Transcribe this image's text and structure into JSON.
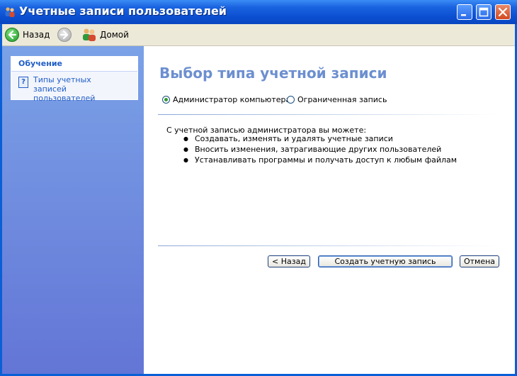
{
  "window": {
    "title": "Учетные записи пользователей",
    "accent": "#0a5fd6"
  },
  "toolbar": {
    "back_label": "Назад",
    "home_label": "Домой"
  },
  "sidebar": {
    "learn_title": "Обучение",
    "learn_link": "Типы учетных записей пользователей"
  },
  "main": {
    "heading": "Выбор типа учетной записи",
    "options": {
      "admin": "Администратор компьютера",
      "limited": "Ограниченная запись",
      "selected": "admin"
    },
    "description": "С учетной записью администратора вы можете:",
    "bullets": [
      "Создавать, изменять и удалять учетные записи",
      "Вносить изменения, затрагивающие других пользователей",
      "Устанавливать программы и получать доступ к любым файлам"
    ],
    "buttons": {
      "back": "< Назад",
      "create": "Создать учетную запись",
      "cancel": "Отмена"
    }
  },
  "icons": {
    "title": "users-icon",
    "back": "back-arrow-icon",
    "forward": "forward-arrow-icon",
    "home": "home-users-icon",
    "help": "help-icon",
    "minimize": "minimize-icon",
    "maximize": "maximize-icon",
    "close": "close-icon"
  }
}
